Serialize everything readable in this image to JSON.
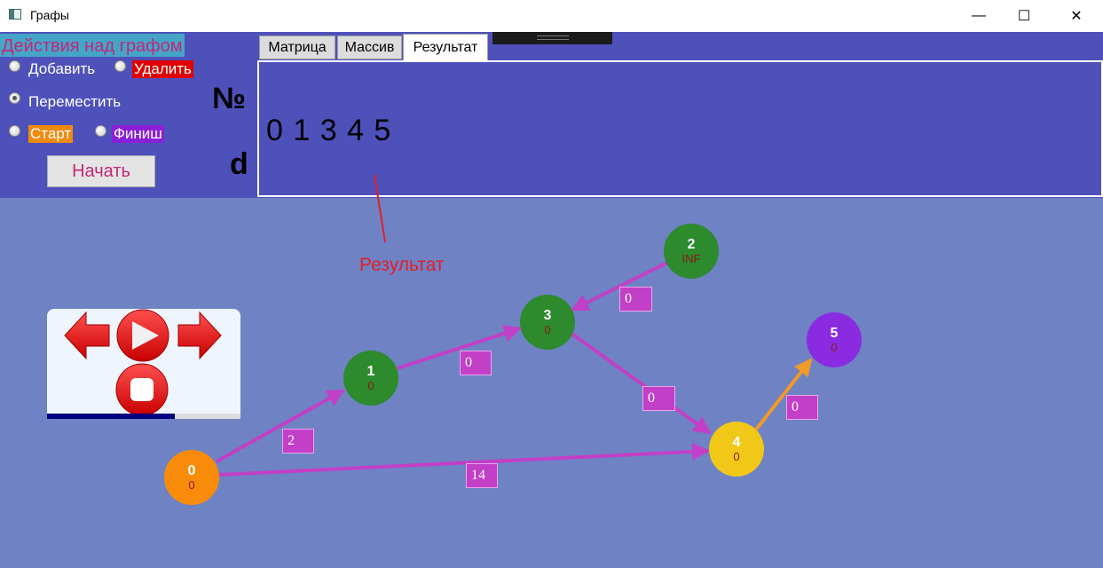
{
  "window": {
    "title": "Графы",
    "minimize_glyph": "—",
    "maximize_glyph": "☐",
    "close_glyph": "✕"
  },
  "panel": {
    "title": "Действия над графом",
    "add_label": "Добавить",
    "delete_label": "Удалить",
    "move_label": "Переместить",
    "start_label": "Старт",
    "finish_label": "Финиш",
    "selected_mode": "Переместить",
    "begin_button": "Начать"
  },
  "row_labels": {
    "number": "№",
    "distance": "d"
  },
  "tabs": [
    {
      "label": "Матрица",
      "active": false
    },
    {
      "label": "Массив",
      "active": false
    },
    {
      "label": "Результат",
      "active": true
    }
  ],
  "result": {
    "sequence": "0 1 3 4 5",
    "annotation": "Результат"
  },
  "player": {
    "progress": 0.66,
    "icons": [
      "arrow-left-icon",
      "play-icon",
      "arrow-right-icon",
      "stop-icon"
    ]
  },
  "graph": {
    "nodes": [
      {
        "id": "0",
        "dist": "0",
        "color": "#f88c0a"
      },
      {
        "id": "1",
        "dist": "0",
        "color": "#2d8a2d"
      },
      {
        "id": "2",
        "dist": "INF",
        "color": "#2d8a2d"
      },
      {
        "id": "3",
        "dist": "0",
        "color": "#2d8a2d"
      },
      {
        "id": "4",
        "dist": "0",
        "color": "#f2c818"
      },
      {
        "id": "5",
        "dist": "0",
        "color": "#8a2be2"
      }
    ],
    "edges": [
      {
        "from": "0",
        "to": "1",
        "weight": "2",
        "color": "#c23fc7"
      },
      {
        "from": "1",
        "to": "3",
        "weight": "0",
        "color": "#c23fc7"
      },
      {
        "from": "2",
        "to": "3",
        "weight": "0",
        "color": "#c23fc7"
      },
      {
        "from": "3",
        "to": "4",
        "weight": "0",
        "color": "#c23fc7"
      },
      {
        "from": "0",
        "to": "4",
        "weight": "14",
        "color": "#c23fc7"
      },
      {
        "from": "4",
        "to": "5",
        "weight": "0",
        "color": "#ef9a2a"
      }
    ]
  }
}
